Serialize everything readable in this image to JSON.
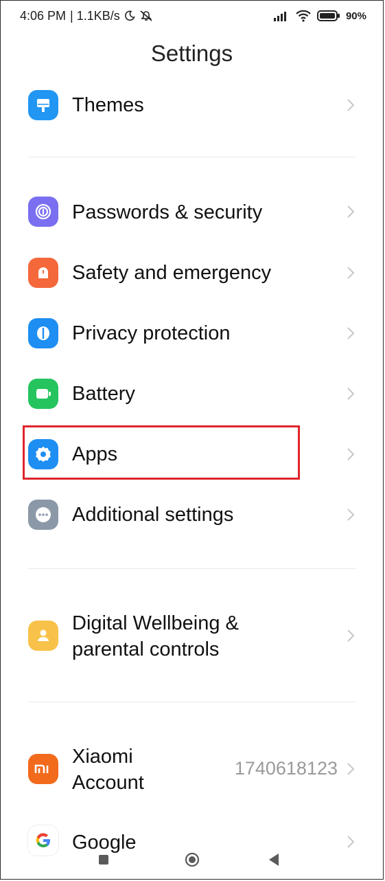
{
  "status_bar": {
    "time": "4:06 PM",
    "speed": "| 1.1KB/s",
    "battery": "90%"
  },
  "header": {
    "title": "Settings"
  },
  "items": [
    {
      "label": "Themes",
      "icon": "themes-icon",
      "color": "#2196f3"
    },
    {
      "label": "Passwords & security",
      "icon": "fingerprint-icon",
      "color": "#7a6ff0"
    },
    {
      "label": "Safety and emergency",
      "icon": "emergency-icon",
      "color": "#f4683b"
    },
    {
      "label": "Privacy protection",
      "icon": "privacy-icon",
      "color": "#1e8ef2"
    },
    {
      "label": "Battery",
      "icon": "battery-icon",
      "color": "#25c45e"
    },
    {
      "label": "Apps",
      "icon": "gear-icon",
      "color": "#1e8ef2"
    },
    {
      "label": "Additional settings",
      "icon": "more-icon",
      "color": "#8b98a8"
    },
    {
      "label_line1": "Digital Wellbeing &",
      "label_line2": "parental controls",
      "icon": "wellbeing-icon",
      "color": "#f8c24a"
    },
    {
      "label_line1": "Xiaomi",
      "label_line2": "Account",
      "value": "1740618123",
      "icon": "mi-icon",
      "color": "#f26a1b"
    },
    {
      "label": "Google",
      "icon": "google-icon",
      "color": "#ffffff"
    }
  ],
  "highlight_color": "#e0242b"
}
